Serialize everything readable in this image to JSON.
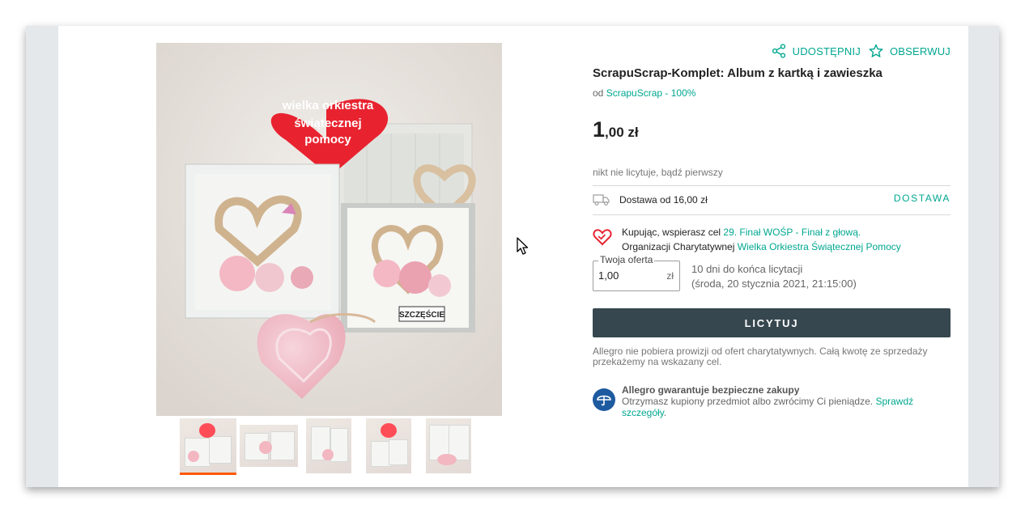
{
  "actions": {
    "share_label": "UDOSTĘPNIJ",
    "watch_label": "OBSERWUJ"
  },
  "product": {
    "title": "ScrapuScrap-Komplet: Album z kartką i zawieszka",
    "seller_prefix": "od",
    "seller_name": "ScrapuScrap - 100%"
  },
  "price": {
    "integer": "1",
    "fraction": ",00 zł"
  },
  "bids_status": "nikt nie licytuje, bądź pierwszy",
  "delivery": {
    "text": "Dostawa od 16,00 zł",
    "link_label": "DOSTAWA"
  },
  "charity": {
    "line1_text": "Kupując, wspierasz cel ",
    "line1_link": "29. Finał WOŚP - Finał z głową.",
    "line2_text": "Organizacji Charytatywnej ",
    "line2_link": "Wielka Orkiestra Świątecznej Pomocy"
  },
  "offer": {
    "label": "Twoja oferta",
    "value": "1,00",
    "unit": "zł"
  },
  "time_left": {
    "line1": "10 dni do końca licytacji",
    "line2": "(środa, 20 stycznia 2021, 21:15:00)"
  },
  "bid_button_label": "LICYTUJ",
  "charity_info": "Allegro nie pobiera prowizji od ofert charytatywnych. Całą kwotę ze sprzedaży przekażemy na wskazany cel.",
  "guarantee": {
    "title": "Allegro gwarantuje bezpieczne zakupy",
    "text": "Otrzymasz kupiony przedmiot albo zwrócimy Ci pieniądze. ",
    "link": "Sprawdź szczegóły",
    "suffix": "."
  },
  "image_text": {
    "heart_line1": "wielka orkiestra",
    "heart_line2": "świątecznej",
    "heart_line3": "pomocy",
    "card_banner": "SZCZĘŚCIE"
  },
  "thumbnails": [
    "thumb-1",
    "thumb-2",
    "thumb-3",
    "thumb-4",
    "thumb-5"
  ],
  "colors": {
    "accent": "#00a790",
    "button": "#37474f",
    "active_thumb": "#ff5a00",
    "heart": "#e8232f"
  }
}
